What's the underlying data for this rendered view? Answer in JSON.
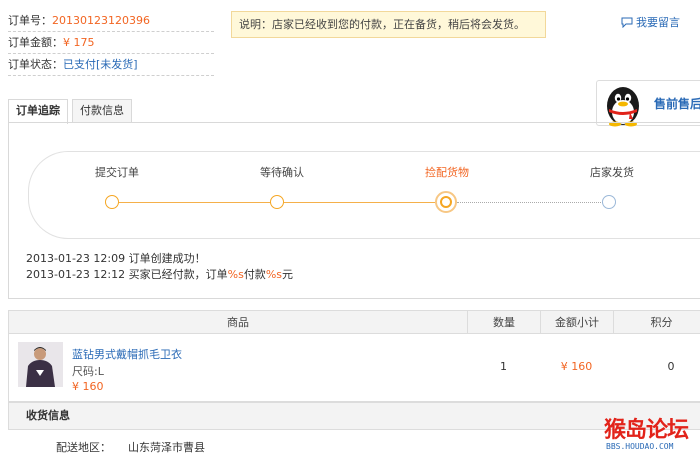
{
  "order": {
    "no_label": "订单号：",
    "no_value": "20130123120396",
    "amount_label": "订单金额：",
    "amount_value": "¥ 175",
    "status_label": "订单状态：",
    "status_value": "已支付[未发货]"
  },
  "notice": "说明：店家已经收到您的付款，正在备货，稍后将会发货。",
  "leave_message": "我要留言",
  "support": {
    "label": "售前售后"
  },
  "tabs": [
    "订单追踪",
    "付款信息"
  ],
  "progress": {
    "steps": [
      {
        "label": "提交订单",
        "state": "done"
      },
      {
        "label": "等待确认",
        "state": "done"
      },
      {
        "label": "捡配货物",
        "state": "current"
      },
      {
        "label": "店家发货",
        "state": "todo"
      }
    ]
  },
  "log": [
    {
      "time": "2013-01-23 12:09",
      "text": "订单创建成功！"
    },
    {
      "time": "2013-01-23 12:12",
      "text_a": "买家已经付款，订单",
      "hl1": "%s",
      "text_b": "付款",
      "hl2": "%s",
      "text_c": "元"
    }
  ],
  "table": {
    "headers": {
      "product": "商品",
      "qty": "数量",
      "subtotal": "金额小计",
      "points": "积分"
    },
    "rows": [
      {
        "name": "蓝钻男式戴帽抓毛卫衣",
        "size": "尺码:L",
        "price": "¥ 160",
        "qty": "1",
        "subtotal": "¥ 160",
        "points": "0"
      }
    ]
  },
  "shipping": {
    "title": "收货信息",
    "region_label": "配送地区：",
    "region_value": "山东菏泽市曹县"
  },
  "watermark": {
    "text": "猴岛论坛",
    "sub": "BBS.HOUDAO.COM"
  },
  "colors": {
    "accent": "#f26522",
    "link": "#2a6ab6",
    "progress": "#f5a623"
  }
}
